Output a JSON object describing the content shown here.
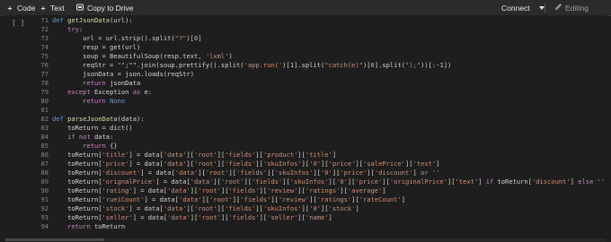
{
  "toolbar": {
    "code_label": "Code",
    "text_label": "Text",
    "drive_label": "Copy to Drive",
    "connect_label": "Connect",
    "editing_label": "Editing"
  },
  "icons": {
    "plus": "plus-icon",
    "drive": "drive-icon",
    "pencil": "pencil-icon",
    "dropdown": "chevron-down-icon"
  },
  "cell": {
    "run_indicator": "[ ]",
    "lines": [
      {
        "n": "71",
        "t": [
          [
            "kw2",
            "def "
          ],
          [
            "fn",
            "getJsonData"
          ],
          [
            "tx",
            "(url):"
          ]
        ]
      },
      {
        "n": "72",
        "t": [
          [
            "tx",
            "    "
          ],
          [
            "kw",
            "try"
          ],
          [
            "tx",
            ":"
          ]
        ]
      },
      {
        "n": "73",
        "t": [
          [
            "tx",
            "        url = url.strip().split("
          ],
          [
            "str",
            "\"?\""
          ],
          [
            "tx",
            ")["
          ],
          [
            "num",
            "0"
          ],
          [
            "tx",
            "]"
          ]
        ]
      },
      {
        "n": "74",
        "t": [
          [
            "tx",
            "        resp = get(url)"
          ]
        ]
      },
      {
        "n": "75",
        "t": [
          [
            "tx",
            "        soup = BeautifulSoup(resp.text, "
          ],
          [
            "str",
            "'lxml'"
          ],
          [
            "tx",
            ")"
          ]
        ]
      },
      {
        "n": "76",
        "t": [
          [
            "tx",
            "        reqStr = "
          ],
          [
            "str",
            "\"\""
          ],
          [
            "tx",
            ";\"\".join(soup.prettify().split("
          ],
          [
            "str",
            "'app.run('"
          ],
          [
            "tx",
            ")["
          ],
          [
            "num",
            "1"
          ],
          [
            "tx",
            "].split("
          ],
          [
            "str",
            "\"catch(e)\""
          ],
          [
            "tx",
            ")["
          ],
          [
            "num",
            "0"
          ],
          [
            "tx",
            "].split("
          ],
          [
            "str",
            "\");\""
          ],
          [
            "tx",
            "))[:-1])"
          ]
        ]
      },
      {
        "n": "77",
        "t": [
          [
            "tx",
            "        jsonData = json.loads(reqStr)"
          ]
        ]
      },
      {
        "n": "78",
        "t": [
          [
            "tx",
            "        "
          ],
          [
            "kw",
            "return"
          ],
          [
            "tx",
            " jsonData"
          ]
        ]
      },
      {
        "n": "79",
        "t": [
          [
            "tx",
            "    "
          ],
          [
            "kw",
            "except"
          ],
          [
            "tx",
            " Exception "
          ],
          [
            "kw",
            "as"
          ],
          [
            "tx",
            " e:"
          ]
        ]
      },
      {
        "n": "80",
        "t": [
          [
            "tx",
            "        "
          ],
          [
            "kw",
            "return"
          ],
          [
            "tx",
            " "
          ],
          [
            "kw2",
            "None"
          ]
        ]
      },
      {
        "n": "81",
        "t": [
          [
            "tx",
            ""
          ]
        ]
      },
      {
        "n": "82",
        "t": [
          [
            "kw2",
            "def "
          ],
          [
            "fn",
            "parseJsonData"
          ],
          [
            "tx",
            "(data):"
          ]
        ]
      },
      {
        "n": "83",
        "t": [
          [
            "tx",
            "    toReturn = dict()"
          ]
        ]
      },
      {
        "n": "84",
        "t": [
          [
            "tx",
            "    "
          ],
          [
            "kw",
            "if not"
          ],
          [
            "tx",
            " data:"
          ]
        ]
      },
      {
        "n": "85",
        "t": [
          [
            "tx",
            "        "
          ],
          [
            "kw",
            "return"
          ],
          [
            "tx",
            " {}"
          ]
        ]
      },
      {
        "n": "86",
        "t": [
          [
            "tx",
            "    toReturn["
          ],
          [
            "str",
            "'title'"
          ],
          [
            "tx",
            "] = data["
          ],
          [
            "str",
            "'data'"
          ],
          [
            "tx",
            "]["
          ],
          [
            "str",
            "'root'"
          ],
          [
            "tx",
            "]["
          ],
          [
            "str",
            "'fields'"
          ],
          [
            "tx",
            "]["
          ],
          [
            "str",
            "'product'"
          ],
          [
            "tx",
            "]["
          ],
          [
            "str",
            "'title'"
          ],
          [
            "tx",
            "]"
          ]
        ]
      },
      {
        "n": "87",
        "t": [
          [
            "tx",
            "    toReturn["
          ],
          [
            "str",
            "'price'"
          ],
          [
            "tx",
            "] = data["
          ],
          [
            "str",
            "'data'"
          ],
          [
            "tx",
            "]["
          ],
          [
            "str",
            "'root'"
          ],
          [
            "tx",
            "]["
          ],
          [
            "str",
            "'fields'"
          ],
          [
            "tx",
            "]["
          ],
          [
            "str",
            "'skuInfos'"
          ],
          [
            "tx",
            "]["
          ],
          [
            "str",
            "'0'"
          ],
          [
            "tx",
            "]["
          ],
          [
            "str",
            "'price'"
          ],
          [
            "tx",
            "]["
          ],
          [
            "str",
            "'salePrice'"
          ],
          [
            "tx",
            "]["
          ],
          [
            "str",
            "'text'"
          ],
          [
            "tx",
            "]"
          ]
        ]
      },
      {
        "n": "88",
        "t": [
          [
            "tx",
            "    toReturn["
          ],
          [
            "str",
            "'discount'"
          ],
          [
            "tx",
            "] = data["
          ],
          [
            "str",
            "'data'"
          ],
          [
            "tx",
            "]["
          ],
          [
            "str",
            "'root'"
          ],
          [
            "tx",
            "]["
          ],
          [
            "str",
            "'fields'"
          ],
          [
            "tx",
            "]["
          ],
          [
            "str",
            "'skuInfos'"
          ],
          [
            "tx",
            "]["
          ],
          [
            "str",
            "'0'"
          ],
          [
            "tx",
            "]["
          ],
          [
            "str",
            "'price'"
          ],
          [
            "tx",
            "]["
          ],
          [
            "str",
            "'discount'"
          ],
          [
            "tx",
            "] "
          ],
          [
            "kw",
            "or"
          ],
          [
            "tx",
            " "
          ],
          [
            "str",
            "''"
          ]
        ]
      },
      {
        "n": "89",
        "t": [
          [
            "tx",
            "    toReturn["
          ],
          [
            "str",
            "'orignalPrice'"
          ],
          [
            "tx",
            "] = data["
          ],
          [
            "str",
            "'data'"
          ],
          [
            "tx",
            "]["
          ],
          [
            "str",
            "'root'"
          ],
          [
            "tx",
            "]["
          ],
          [
            "str",
            "'fields'"
          ],
          [
            "tx",
            "]["
          ],
          [
            "str",
            "'skuInfos'"
          ],
          [
            "tx",
            "]["
          ],
          [
            "str",
            "'0'"
          ],
          [
            "tx",
            "]["
          ],
          [
            "str",
            "'price'"
          ],
          [
            "tx",
            "]["
          ],
          [
            "str",
            "'originalPrice'"
          ],
          [
            "tx",
            "]["
          ],
          [
            "str",
            "'text'"
          ],
          [
            "tx",
            "] "
          ],
          [
            "kw",
            "if"
          ],
          [
            "tx",
            " toReturn["
          ],
          [
            "str",
            "'discount'"
          ],
          [
            "tx",
            "] "
          ],
          [
            "kw",
            "else"
          ],
          [
            "tx",
            " "
          ],
          [
            "str",
            "''"
          ]
        ]
      },
      {
        "n": "90",
        "t": [
          [
            "tx",
            "    toReturn["
          ],
          [
            "str",
            "'rating'"
          ],
          [
            "tx",
            "] = data["
          ],
          [
            "str",
            "'data'"
          ],
          [
            "tx",
            "]["
          ],
          [
            "str",
            "'root'"
          ],
          [
            "tx",
            "]["
          ],
          [
            "str",
            "'fields'"
          ],
          [
            "tx",
            "]["
          ],
          [
            "str",
            "'review'"
          ],
          [
            "tx",
            "]["
          ],
          [
            "str",
            "'ratings'"
          ],
          [
            "tx",
            "]["
          ],
          [
            "str",
            "'average'"
          ],
          [
            "tx",
            "]"
          ]
        ]
      },
      {
        "n": "91",
        "t": [
          [
            "tx",
            "    toReturn["
          ],
          [
            "str",
            "'rueiCount'"
          ],
          [
            "tx",
            "] = data["
          ],
          [
            "str",
            "'data'"
          ],
          [
            "tx",
            "]["
          ],
          [
            "str",
            "'root'"
          ],
          [
            "tx",
            "]["
          ],
          [
            "str",
            "'fields'"
          ],
          [
            "tx",
            "]["
          ],
          [
            "str",
            "'review'"
          ],
          [
            "tx",
            "]["
          ],
          [
            "str",
            "'ratings'"
          ],
          [
            "tx",
            "]["
          ],
          [
            "str",
            "'rateCount'"
          ],
          [
            "tx",
            "]"
          ]
        ]
      },
      {
        "n": "92",
        "t": [
          [
            "tx",
            "    toReturn["
          ],
          [
            "str",
            "'stock'"
          ],
          [
            "tx",
            "] = data["
          ],
          [
            "str",
            "'data'"
          ],
          [
            "tx",
            "]["
          ],
          [
            "str",
            "'root'"
          ],
          [
            "tx",
            "]["
          ],
          [
            "str",
            "'fields'"
          ],
          [
            "tx",
            "]["
          ],
          [
            "str",
            "'skuInfos'"
          ],
          [
            "tx",
            "]["
          ],
          [
            "str",
            "'0'"
          ],
          [
            "tx",
            "]["
          ],
          [
            "str",
            "'stock'"
          ],
          [
            "tx",
            "]"
          ]
        ]
      },
      {
        "n": "93",
        "t": [
          [
            "tx",
            "    toReturn["
          ],
          [
            "str",
            "'seller'"
          ],
          [
            "tx",
            "] = data["
          ],
          [
            "str",
            "'data'"
          ],
          [
            "tx",
            "]["
          ],
          [
            "str",
            "'root'"
          ],
          [
            "tx",
            "]["
          ],
          [
            "str",
            "'fields'"
          ],
          [
            "tx",
            "]["
          ],
          [
            "str",
            "'seller'"
          ],
          [
            "tx",
            "]["
          ],
          [
            "str",
            "'name'"
          ],
          [
            "tx",
            "]"
          ]
        ]
      },
      {
        "n": "94",
        "t": [
          [
            "tx",
            "    "
          ],
          [
            "kw",
            "return"
          ],
          [
            "tx",
            " toReturn"
          ]
        ]
      }
    ]
  },
  "colors": {
    "background": "#1e1e1e",
    "keyword": "#c586c0",
    "keyword_def": "#569cd6",
    "function": "#dcdcaa",
    "string": "#ce9178",
    "text": "#d4d4d4",
    "line_number": "#858585"
  }
}
